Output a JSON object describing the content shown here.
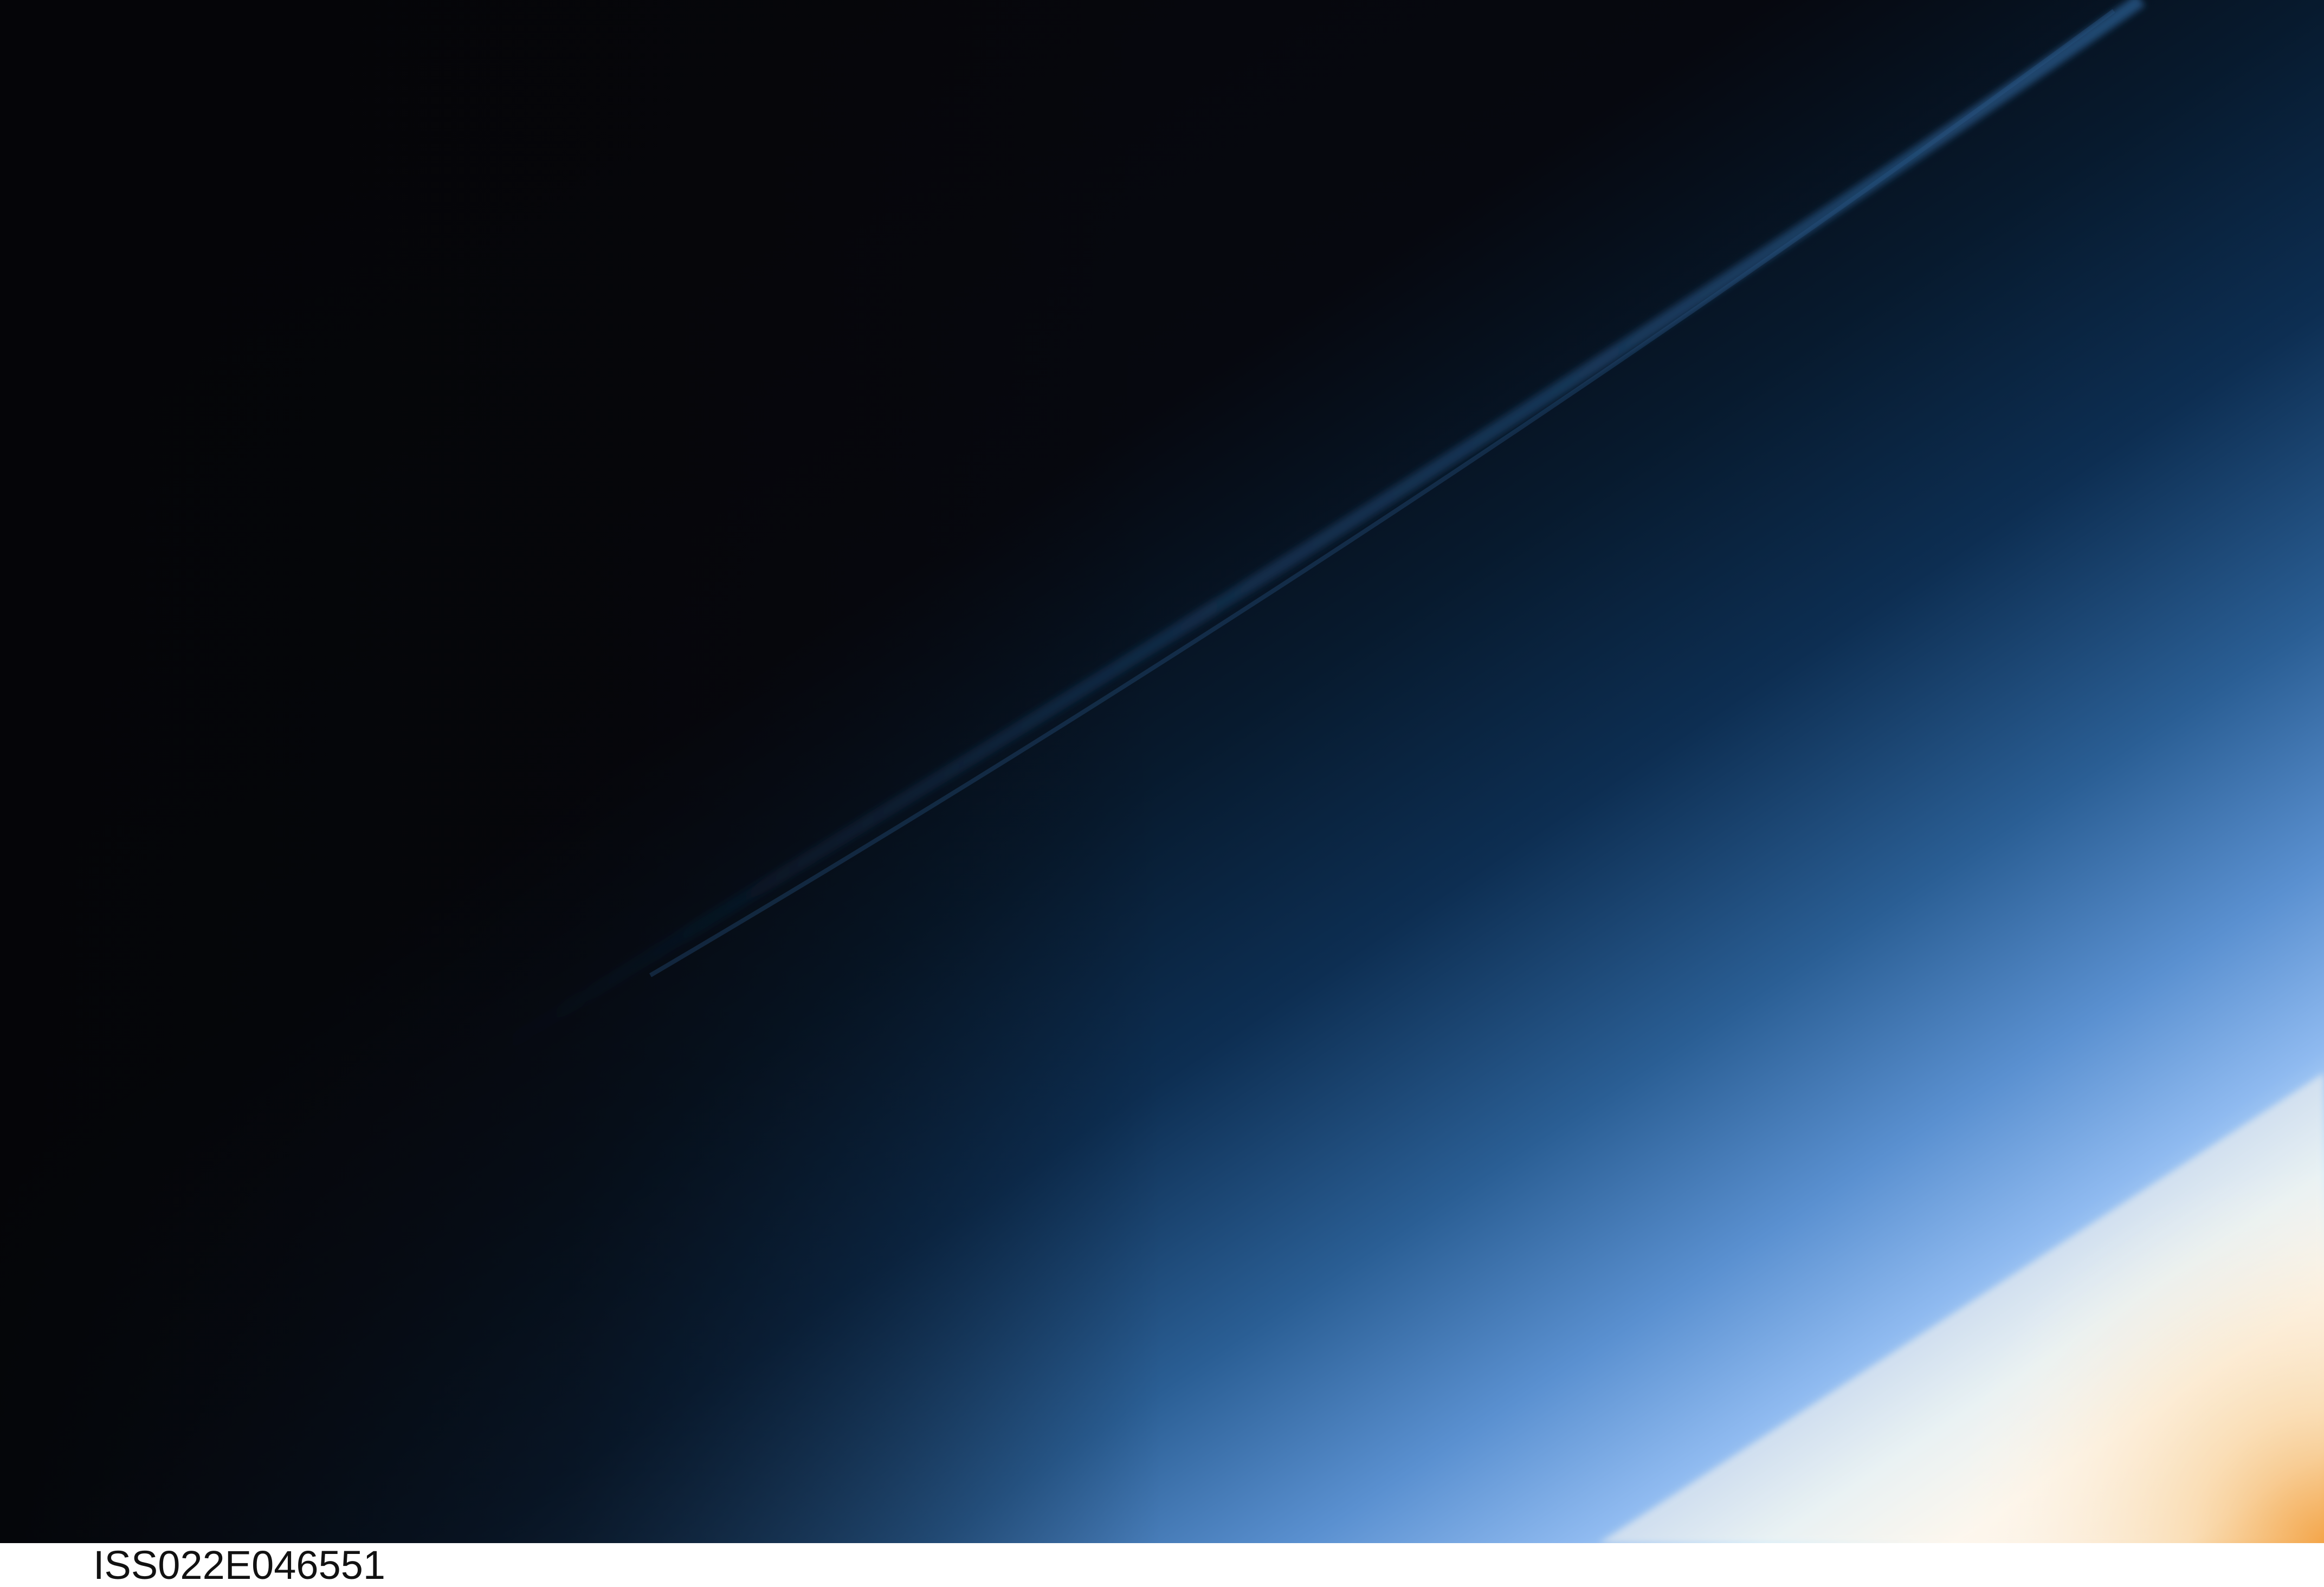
{
  "photo": {
    "caption": "ISS022E046551",
    "colors": {
      "space": "#050508",
      "upper_atmosphere": "#0a2a4a",
      "mid_atmosphere": "#3f7ab8",
      "lower_atmosphere": "#8fbaf0",
      "horizon_glow": "#fdf7ee",
      "sunrise_edge": "#f0a04a"
    }
  }
}
